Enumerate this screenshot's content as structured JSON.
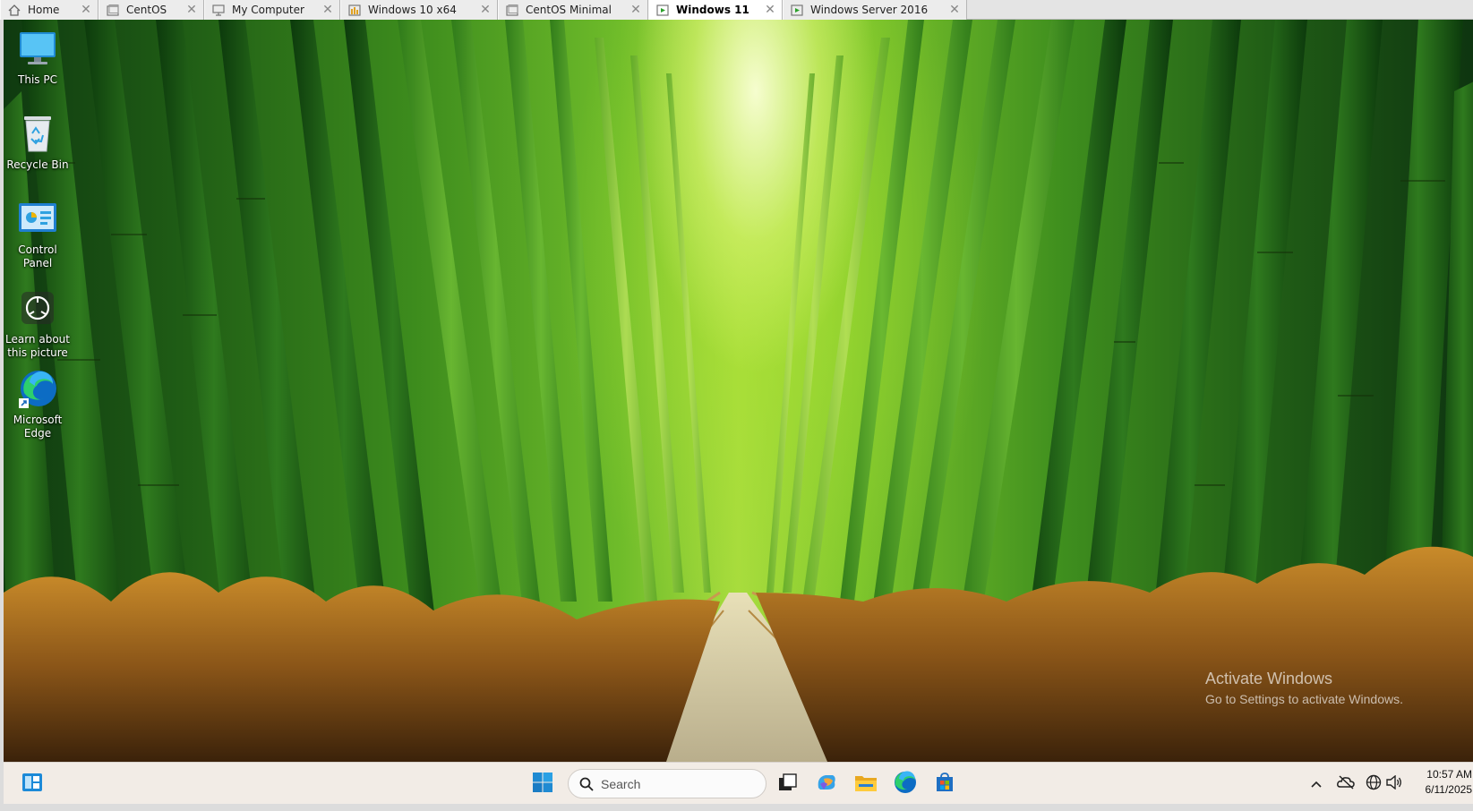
{
  "tabs": [
    {
      "label": "Home",
      "icon": "home-icon",
      "active": false
    },
    {
      "label": "CentOS",
      "icon": "vm-icon",
      "active": false
    },
    {
      "label": "My Computer",
      "icon": "computer-icon",
      "active": false
    },
    {
      "label": "Windows 10 x64",
      "icon": "vm-running-icon",
      "active": false
    },
    {
      "label": "CentOS Minimal",
      "icon": "vm-icon",
      "active": false
    },
    {
      "label": "Windows 11",
      "icon": "vm-running-icon",
      "active": true
    },
    {
      "label": "Windows Server 2016",
      "icon": "vm-running-icon",
      "active": false
    }
  ],
  "desktop": {
    "icons": [
      {
        "label": "This PC",
        "icon": "this-pc-icon"
      },
      {
        "label": "Recycle Bin",
        "icon": "recycle-bin-icon"
      },
      {
        "label": "Control Panel",
        "icon": "control-panel-icon"
      },
      {
        "label": "Learn about this picture",
        "icon": "learn-about-picture-icon"
      },
      {
        "label": "Microsoft Edge",
        "icon": "edge-icon"
      }
    ],
    "watermark": {
      "title": "Activate Windows",
      "subtitle": "Go to Settings to activate Windows."
    }
  },
  "taskbar": {
    "search_placeholder": "Search",
    "apps": [
      "widgets-icon",
      "start-icon",
      "task-view-icon",
      "copilot-icon",
      "file-explorer-icon",
      "edge-icon",
      "store-icon"
    ],
    "tray": [
      "show-hidden-icons-chevron",
      "onedrive-offline-icon",
      "network-icon",
      "volume-icon"
    ],
    "time": "10:57 AM",
    "date": "6/11/2025"
  },
  "colors": {
    "taskbar": "#f2ece6",
    "active_tab": "#ffffff",
    "start_blue": "#1f8ad2"
  }
}
